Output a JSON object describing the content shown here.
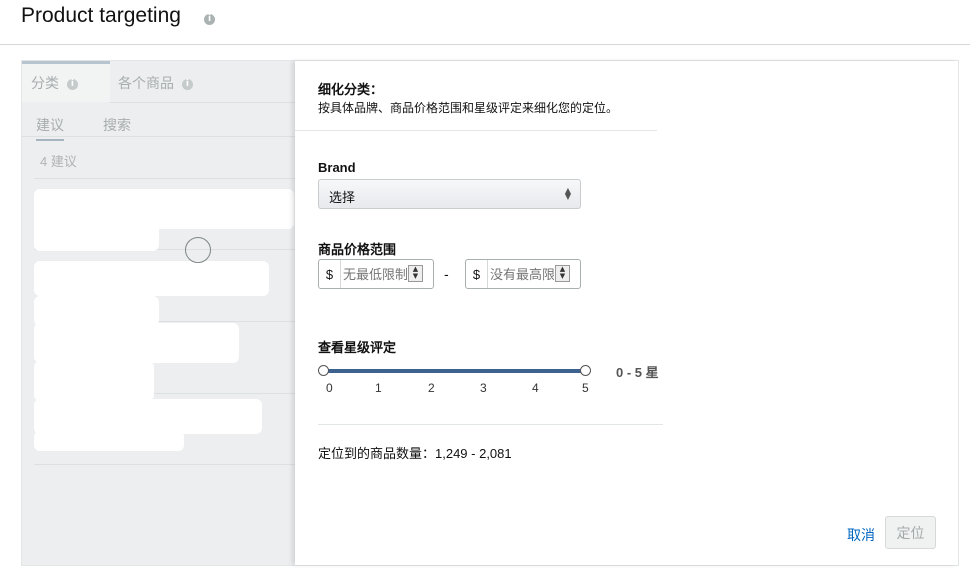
{
  "header": {
    "title": "Product targeting",
    "info_icon": "info-icon"
  },
  "left_pane": {
    "tabs": [
      {
        "label": "分类",
        "icon": "info-icon",
        "active": true
      },
      {
        "label": "各个商品",
        "icon": "info-icon",
        "active": false
      }
    ],
    "subtabs": [
      {
        "label": "建议",
        "active": true
      },
      {
        "label": "搜索",
        "active": false
      }
    ],
    "count_text": "4 建议",
    "loading_icon": "loading-spinner-icon"
  },
  "refine": {
    "title": "细化分类：",
    "description": "按具体品牌、商品价格范围和星级评定来细化您的定位。",
    "brand": {
      "label": "Brand",
      "selected": "选择",
      "arrow_icon": "select-arrows-icon"
    },
    "price": {
      "label": "商品价格范围",
      "currency": "$",
      "min_placeholder": "无最低限制",
      "max_placeholder": "没有最高限制",
      "separator": "-",
      "stepper_icon": "stepper-arrows-icon"
    },
    "rating": {
      "label": "查看星级评定",
      "ticks": [
        "0",
        "1",
        "2",
        "3",
        "4",
        "5"
      ],
      "range_min": 0,
      "range_max": 5,
      "range_text": "0 - 5 星"
    },
    "result_text": "定位到的商品数量：1,249 - 2,081"
  },
  "actions": {
    "cancel_label": "取消",
    "target_label": "定位"
  },
  "colors": {
    "slider_track": "#3e6290",
    "link": "#0066c0",
    "left_pane_bg": "#eceeef"
  }
}
